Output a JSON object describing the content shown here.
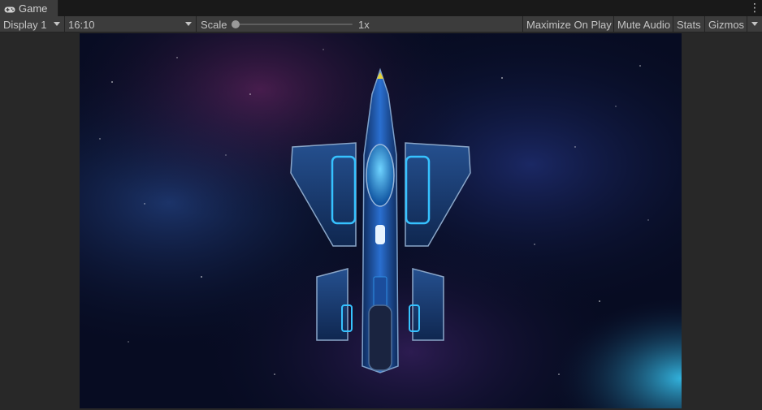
{
  "tab": {
    "title": "Game",
    "icon": "gamepad-icon"
  },
  "window_menu_icon": "kebab-menu-icon",
  "toolbar": {
    "display": "Display 1",
    "aspect": "16:10",
    "scale_label": "Scale",
    "scale_value": "1x",
    "scale_level": 0,
    "maximize": "Maximize On Play",
    "mute": "Mute Audio",
    "stats": "Stats",
    "gizmos": "Gizmos"
  },
  "colors": {
    "editor_bg": "#282828",
    "toolbar_bg": "#3c3c3c",
    "space_bg": "#050a1c",
    "ship_blue": "#1f5fb8",
    "ship_accent": "#3fb3ff"
  }
}
